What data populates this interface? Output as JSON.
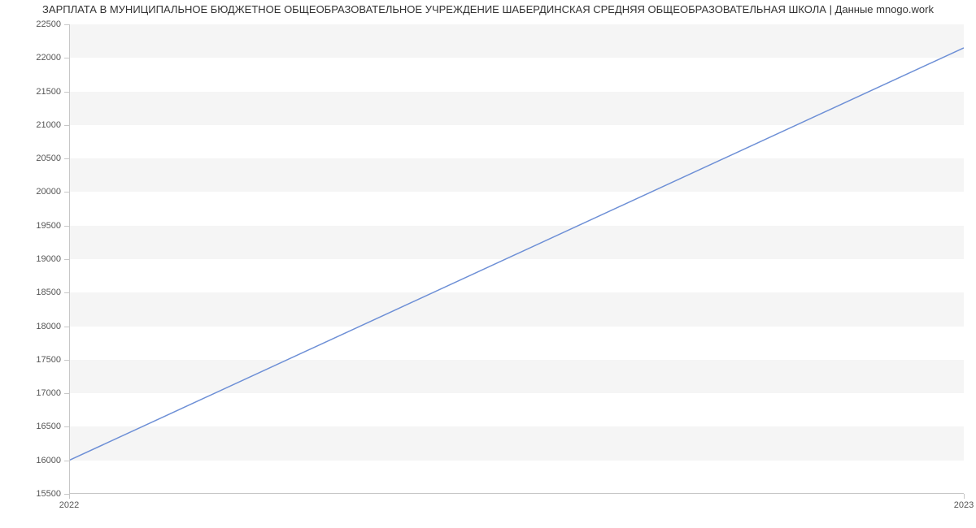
{
  "chart_data": {
    "type": "line",
    "title": "ЗАРПЛАТА В МУНИЦИПАЛЬНОЕ БЮДЖЕТНОЕ ОБЩЕОБРАЗОВАТЕЛЬНОЕ УЧРЕЖДЕНИЕ ШАБЕРДИНСКАЯ СРЕДНЯЯ ОБЩЕОБРАЗОВАТЕЛЬНАЯ ШКОЛА | Данные mnogo.work",
    "x": [
      2022,
      2023
    ],
    "values": [
      16000,
      22150
    ],
    "xlabel": "",
    "ylabel": "",
    "ylim": [
      15500,
      22500
    ],
    "y_ticks": [
      15500,
      16000,
      16500,
      17000,
      17500,
      18000,
      18500,
      19000,
      19500,
      20000,
      20500,
      21000,
      21500,
      22000,
      22500
    ],
    "x_ticks": [
      2022,
      2023
    ],
    "line_color": "#6d8fd6",
    "grid_band_color": "#f5f5f5"
  }
}
